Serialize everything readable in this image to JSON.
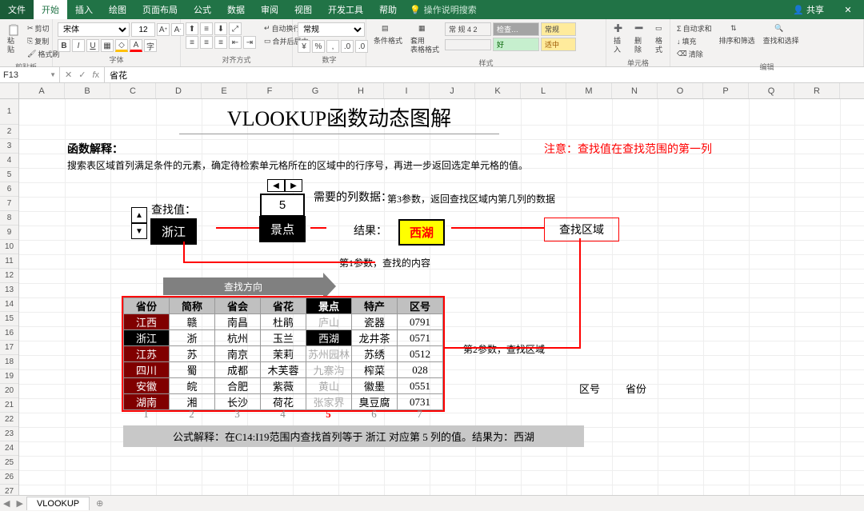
{
  "menu": {
    "file": "文件",
    "home": "开始",
    "insert": "插入",
    "draw": "绘图",
    "layout": "页面布局",
    "formula": "公式",
    "data": "数据",
    "review": "审阅",
    "view": "视图",
    "dev": "开发工具",
    "help": "帮助",
    "search": "操作说明搜索",
    "share": "共享"
  },
  "ribbon": {
    "clipboard": {
      "label": "剪贴板",
      "paste": "粘贴",
      "cut": "剪切",
      "copy": "复制",
      "format_painter": "格式刷"
    },
    "font": {
      "label": "字体",
      "family": "宋体",
      "size": "12"
    },
    "align": {
      "label": "对齐方式",
      "wrap": "自动换行",
      "merge": "合并后居中"
    },
    "number": {
      "label": "数字",
      "fmt": "常规"
    },
    "styles": {
      "label": "样式",
      "cond1": "常 规 4 2",
      "cond2": "检查…",
      "cond3": "常规",
      "good": "好",
      "mid": "适中",
      "cond_fmt": "条件格式",
      "tbl_fmt": "套用\n表格格式"
    },
    "cells": {
      "label": "单元格",
      "insert": "插入",
      "delete": "删除",
      "format": "格式"
    },
    "edit": {
      "label": "编辑",
      "sum": "自动求和",
      "fill": "填充",
      "clear": "清除",
      "sort": "排序和筛选",
      "find": "查找和选择"
    }
  },
  "namebox": "F13",
  "formula": "省花",
  "cols": [
    "A",
    "B",
    "C",
    "D",
    "E",
    "F",
    "G",
    "H",
    "I",
    "J",
    "K",
    "L",
    "M",
    "N",
    "O",
    "P",
    "Q",
    "R"
  ],
  "rows_max": 28,
  "sheet": {
    "title": "VLOOKUP函数动态图解",
    "explain_label": "函数解释：",
    "warn": "注意：查找值在查找范围的第一列",
    "desc": "搜索表区域首列满足条件的元素，确定待检索单元格所在的区域中的行序号，再进一步返回选定单元格的值。",
    "lookup_label": "查找值：",
    "lookup_value": "浙江",
    "cols_needed_label": "需要的列数据：",
    "cols_needed_value": "5",
    "cols_needed_name": "景点",
    "param3_note": "第3参数，返回查找区域内第几列的数据",
    "result_label": "结果：",
    "result_value": "西湖",
    "lookup_range_label": "查找区域",
    "param1_note": "第1参数，查找的内容",
    "param2_note": "第2参数，查找区域",
    "direction": "查找方向",
    "headers": [
      "省份",
      "简称",
      "省会",
      "省花",
      "景点",
      "特产",
      "区号"
    ],
    "hilite_col": 4,
    "sel_row": 1,
    "rows": [
      [
        "江西",
        "赣",
        "南昌",
        "杜鹃",
        "庐山",
        "瓷器",
        "0791"
      ],
      [
        "浙江",
        "浙",
        "杭州",
        "玉兰",
        "西湖",
        "龙井茶",
        "0571"
      ],
      [
        "江苏",
        "苏",
        "南京",
        "茉莉",
        "苏州园林",
        "苏绣",
        "0512"
      ],
      [
        "四川",
        "蜀",
        "成都",
        "木芙蓉",
        "九寨沟",
        "榨菜",
        "028"
      ],
      [
        "安徽",
        "皖",
        "合肥",
        "紫薇",
        "黄山",
        "徽墨",
        "0551"
      ],
      [
        "湖南",
        "湘",
        "长沙",
        "荷花",
        "张家界",
        "臭豆腐",
        "0731"
      ]
    ],
    "col_idx": [
      "1",
      "2",
      "3",
      "4",
      "5",
      "6",
      "7"
    ],
    "col_idx_hilite": 4,
    "extra_m": "区号",
    "extra_n": "省份",
    "formula_line": "公式解释：在C14:I19范围内查找首列等于 浙江 对应第 5 列的值。结果为：西湖"
  },
  "tab": {
    "name": "VLOOKUP"
  }
}
